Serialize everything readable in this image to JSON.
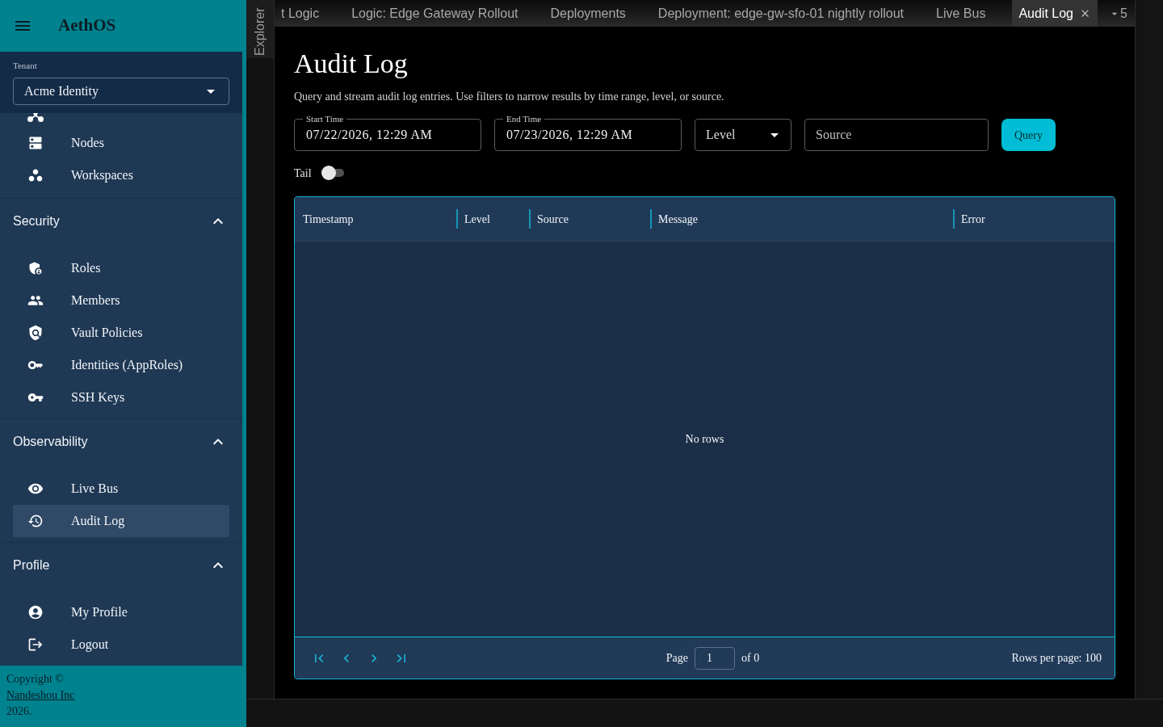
{
  "app_bar": {
    "title": "AethOS"
  },
  "tenant": {
    "label": "Tenant",
    "value": "Acme Identity"
  },
  "nav": {
    "items": [
      {
        "label": "Nodes",
        "selected": false
      },
      {
        "label": "Workspaces",
        "selected": false
      }
    ],
    "sections": [
      {
        "title": "Security",
        "expanded": true,
        "items": [
          {
            "label": "Roles",
            "selected": false
          },
          {
            "label": "Members",
            "selected": false
          },
          {
            "label": "Vault Policies",
            "selected": false
          },
          {
            "label": "Identities (AppRoles)",
            "selected": false
          },
          {
            "label": "SSH Keys",
            "selected": false
          }
        ]
      },
      {
        "title": "Observability",
        "expanded": true,
        "items": [
          {
            "label": "Live Bus",
            "selected": false
          },
          {
            "label": "Audit Log",
            "selected": true
          }
        ]
      },
      {
        "title": "Profile",
        "expanded": true,
        "items": [
          {
            "label": "My Profile",
            "selected": false
          },
          {
            "label": "Logout",
            "selected": false
          }
        ]
      }
    ]
  },
  "footer": {
    "copyright": "Copyright ©",
    "link": "Nandeshou Inc",
    "year": "2026."
  },
  "explorer": {
    "label": "Explorer"
  },
  "tabs": [
    {
      "label": "t Logic",
      "selected": false
    },
    {
      "label": "Logic: Edge Gateway Rollout",
      "selected": false
    },
    {
      "label": "Deployments",
      "selected": false
    },
    {
      "label": "Deployment: edge-gw-sfo-01 nightly rollout",
      "selected": false
    },
    {
      "label": "Live Bus",
      "selected": false
    },
    {
      "label": "Audit Log",
      "selected": true
    }
  ],
  "tab_overflow": {
    "count": "5"
  },
  "page": {
    "title": "Audit Log",
    "description": "Query and stream audit log entries. Use filters to narrow results by time range, level, or source."
  },
  "filters": {
    "start_time": {
      "label": "Start Time",
      "value": "07/22/2026, 12:29 AM"
    },
    "end_time": {
      "label": "End Time",
      "value": "07/23/2026, 12:29 AM"
    },
    "level": {
      "label": "Level"
    },
    "source": {
      "placeholder": "Source"
    },
    "query_button": "Query",
    "tail": {
      "label": "Tail",
      "on": false
    }
  },
  "table": {
    "columns": [
      "Timestamp",
      "Level",
      "Source",
      "Message",
      "Error"
    ],
    "empty_message": "No rows",
    "pagination": {
      "page_label": "Page",
      "page": "1",
      "of_label": "of 0",
      "rows_per_page": "Rows per page: 100"
    }
  }
}
